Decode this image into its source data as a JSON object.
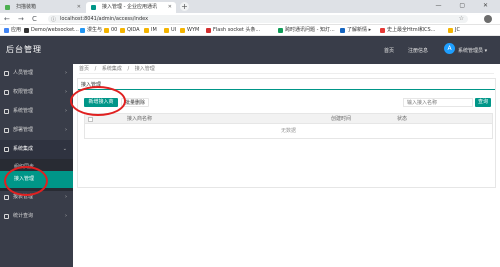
{
  "browser": {
    "tabs": [
      {
        "label": "扫描装箱",
        "active": false,
        "favicon_color": "#4caf50"
      },
      {
        "label": "接入管理 - 企业应用通讯",
        "active": true,
        "favicon_color": "#009688"
      }
    ],
    "new_tab": "+",
    "window_controls": "— ▢ ✕",
    "nav": {
      "back": "←",
      "forward": "→",
      "reload": "C"
    },
    "url": "localhost:8041/admin/access/index",
    "bookmarks": [
      {
        "label": "应用",
        "color": "#4285f4"
      },
      {
        "label": "Demo/websocket...",
        "color": "#333333"
      },
      {
        "label": "漫生与",
        "color": "#2196f3"
      },
      {
        "label": "00",
        "color": "#f4b400"
      },
      {
        "label": "QIDA",
        "color": "#f4b400"
      },
      {
        "label": "IM",
        "color": "#f4b400"
      },
      {
        "label": "UI",
        "color": "#f4b400"
      },
      {
        "label": "WYM",
        "color": "#f4b400"
      },
      {
        "label": "Flash socket 头条...",
        "color": "#d32f2f"
      },
      {
        "label": "跨时通讯问题 - 知灯...",
        "color": "#0f9d58"
      },
      {
        "label": "了解新情 ▸",
        "color": "#1565c0"
      },
      {
        "label": "史上最全Html和CS...",
        "color": "#e53935"
      },
      {
        "label": "JC",
        "color": "#f4b400"
      }
    ]
  },
  "app": {
    "logo": "后台管理",
    "header_links": [
      "首页",
      "注册信息"
    ],
    "user_name": "系统管理员 ▾",
    "user_avatar": "A",
    "sidebar": [
      {
        "label": "人员管理",
        "arrow": "›"
      },
      {
        "label": "权限管理",
        "arrow": "›"
      },
      {
        "label": "系统管理",
        "arrow": "›"
      },
      {
        "label": "部署管理",
        "arrow": "›"
      },
      {
        "label": "系统集成",
        "arrow": "⌄"
      }
    ],
    "sidebar_sub": [
      "组织同步",
      "应用配置",
      "接入管理"
    ],
    "sidebar_bottom": [
      {
        "label": "报表管理",
        "arrow": "›"
      },
      {
        "label": "统计查询",
        "arrow": "›"
      }
    ],
    "breadcrumb": [
      "首页",
      "/",
      "系统集成",
      "/",
      "接入管理"
    ],
    "panel_title": "接入管理",
    "buttons": {
      "add": "新增接入商",
      "batch_delete": "批量删除",
      "search": "查询"
    },
    "search_placeholder": "输入接入名称",
    "table": {
      "columns": [
        "接入商名称",
        "创建时间",
        "状态"
      ],
      "empty": "无数据"
    }
  }
}
